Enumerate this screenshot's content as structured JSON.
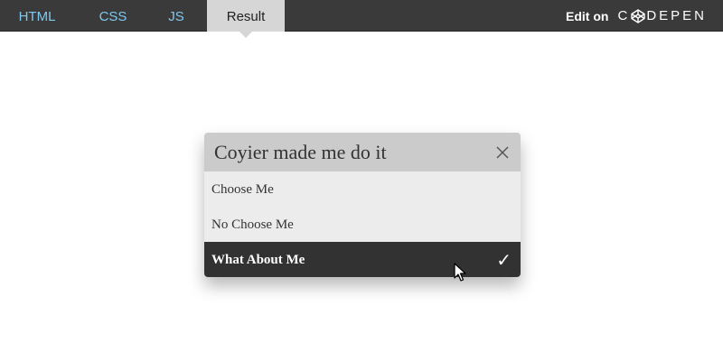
{
  "topbar": {
    "tabs": [
      {
        "label": "HTML"
      },
      {
        "label": "CSS"
      },
      {
        "label": "JS"
      },
      {
        "label": "Result",
        "active": true
      }
    ],
    "edit_label": "Edit on",
    "logo_text": "CODEPEN"
  },
  "dropdown": {
    "title": "Coyier made me do it",
    "options": [
      {
        "label": "Choose Me",
        "selected": false
      },
      {
        "label": "No Choose Me",
        "selected": false
      },
      {
        "label": "What About Me",
        "selected": true
      }
    ],
    "check_icon": "checkmark-icon",
    "close_icon": "close-icon"
  },
  "colors": {
    "topbar_bg": "#3a3a3a",
    "tab_text": "#7fc8ef",
    "active_tab_bg": "#d6d6d6",
    "header_bg": "#cbcbcb",
    "option_bg": "#ececec",
    "selected_bg": "#323232"
  }
}
